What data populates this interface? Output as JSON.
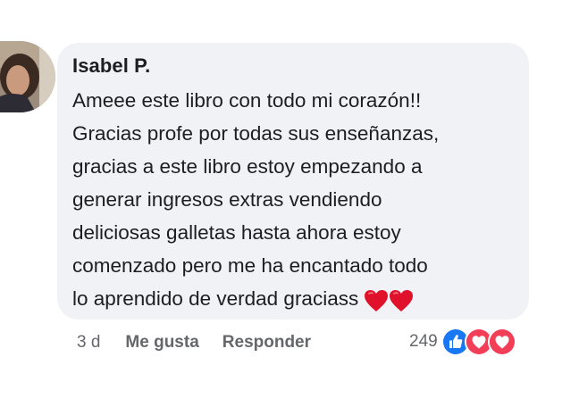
{
  "comment": {
    "author": "Isabel P.",
    "lines": [
      "Ameee este libro con todo mi corazón!!",
      "Gracias profe por todas sus enseñanzas,",
      "gracias a este libro estoy empezando a",
      "generar ingresos extras vendiendo",
      "deliciosas galletas hasta ahora estoy",
      "comenzado pero me ha encantado todo",
      "lo aprendido de verdad graciass"
    ],
    "trailing_emoji": [
      "red-heart-emoji",
      "red-heart-emoji"
    ]
  },
  "actions": {
    "time": "3 d",
    "like_label": "Me gusta",
    "reply_label": "Responder"
  },
  "reactions": {
    "count": "249",
    "icons": [
      "like-reaction-icon",
      "love-reaction-icon",
      "love-reaction-icon"
    ],
    "colors": {
      "like": "#1877f2",
      "love": "#f33e58"
    }
  },
  "colors": {
    "bubble": "#f0f2f5",
    "text": "#1c1e21",
    "meta": "#65676b"
  }
}
